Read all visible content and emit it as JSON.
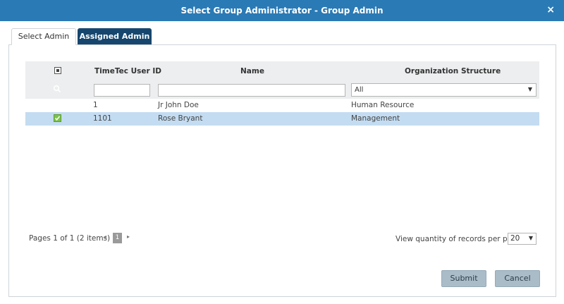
{
  "dialog": {
    "title": "Select Group Administrator - Group Admin",
    "close_label": "×"
  },
  "tabs": [
    {
      "label": "Select Admin",
      "active": true
    },
    {
      "label": "Assigned Admin",
      "active": false
    }
  ],
  "grid": {
    "headers": {
      "user_id": "TimeTec User ID",
      "name": "Name",
      "org": "Organization Structure"
    },
    "filters": {
      "user_id": "",
      "name": "",
      "org_selected": "All"
    },
    "rows": [
      {
        "checked": false,
        "user_id": "1",
        "name": "Jr John Doe",
        "org": "Human Resource",
        "selected": false
      },
      {
        "checked": true,
        "user_id": "1101",
        "name": "Rose Bryant",
        "org": "Management",
        "selected": true
      }
    ]
  },
  "pager": {
    "info": "Pages 1 of 1 (2 items)",
    "current_page": "1",
    "prev_icon": "◂",
    "next_icon": "▸"
  },
  "per_page": {
    "label": "View quantity of records per page",
    "value": "20",
    "arrow": "▼"
  },
  "buttons": {
    "submit": "Submit",
    "cancel": "Cancel"
  },
  "colors": {
    "titlebar": "#2a7ab5",
    "tab_inactive": "#16466e",
    "selected_row": "#c3dcf1",
    "check_green": "#7cc34a",
    "button": "#a9bcc8"
  }
}
